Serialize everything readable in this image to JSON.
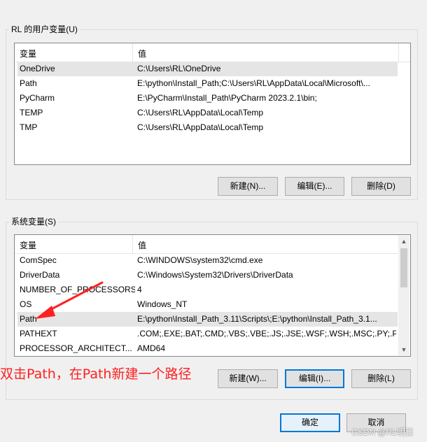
{
  "user_vars": {
    "title": "RL 的用户变量(U)",
    "col_name": "变量",
    "col_value": "值",
    "rows": [
      {
        "name": "OneDrive",
        "value": "C:\\Users\\RL\\OneDrive"
      },
      {
        "name": "Path",
        "value": "E:\\python\\Install_Path;C:\\Users\\RL\\AppData\\Local\\Microsoft\\..."
      },
      {
        "name": "PyCharm",
        "value": "E:\\PyCharm\\Install_Path\\PyCharm 2023.2.1\\bin;"
      },
      {
        "name": "TEMP",
        "value": "C:\\Users\\RL\\AppData\\Local\\Temp"
      },
      {
        "name": "TMP",
        "value": "C:\\Users\\RL\\AppData\\Local\\Temp"
      }
    ],
    "new_label": "新建(N)...",
    "edit_label": "编辑(E)...",
    "delete_label": "删除(D)"
  },
  "sys_vars": {
    "title": "系统变量(S)",
    "col_name": "变量",
    "col_value": "值",
    "rows": [
      {
        "name": "ComSpec",
        "value": "C:\\WINDOWS\\system32\\cmd.exe"
      },
      {
        "name": "DriverData",
        "value": "C:\\Windows\\System32\\Drivers\\DriverData"
      },
      {
        "name": "NUMBER_OF_PROCESSORS",
        "value": "4"
      },
      {
        "name": "OS",
        "value": "Windows_NT"
      },
      {
        "name": "Path",
        "value": "E:\\python\\Install_Path_3.11\\Scripts\\;E:\\python\\Install_Path_3.1..."
      },
      {
        "name": "PATHEXT",
        "value": ".COM;.EXE;.BAT;.CMD;.VBS;.VBE;.JS;.JSE;.WSF;.WSH;.MSC;.PY;.P..."
      },
      {
        "name": "PROCESSOR_ARCHITECT...",
        "value": "AMD64"
      }
    ],
    "new_label": "新建(W)...",
    "edit_label": "编辑(I)...",
    "delete_label": "删除(L)"
  },
  "annotation": "双击Path，在Path新建一个路径",
  "ok_label": "确定",
  "cancel_label": "取消",
  "watermark": "CSDN @RL明日",
  "colors": {
    "annotation": "#ff2020",
    "accent": "#0078d7"
  }
}
